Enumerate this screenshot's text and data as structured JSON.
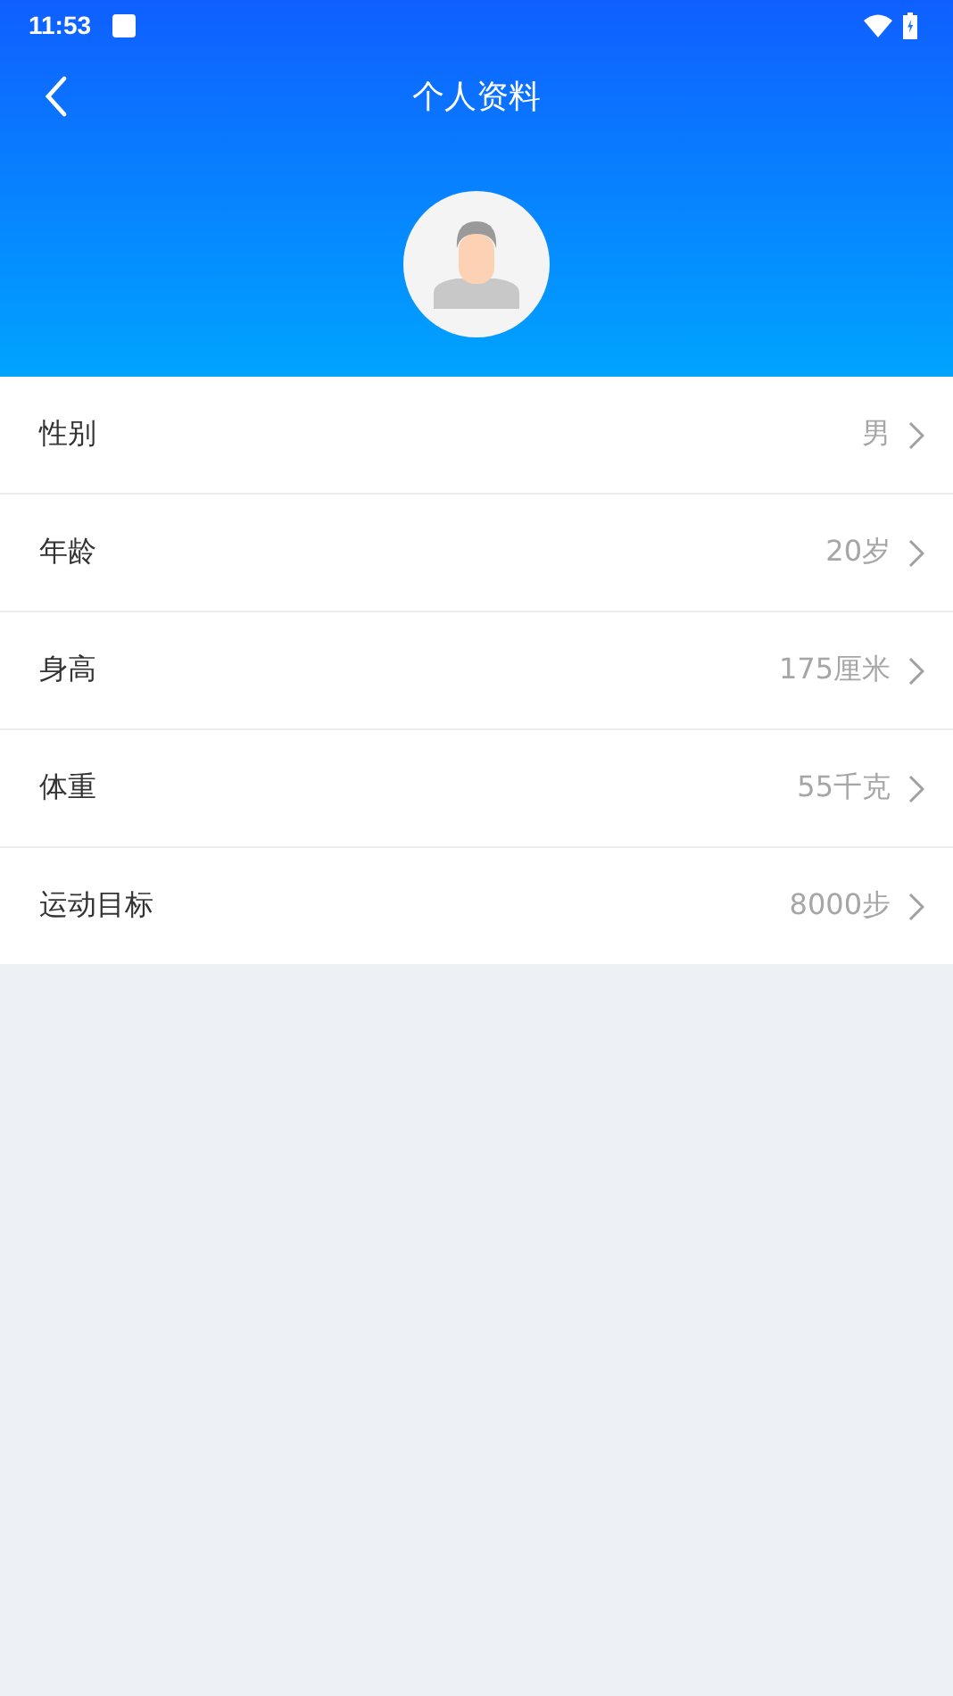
{
  "status_bar": {
    "time": "11:53"
  },
  "header": {
    "title": "个人资料"
  },
  "items": [
    {
      "label": "性别",
      "value": "男"
    },
    {
      "label": "年龄",
      "value": "20岁"
    },
    {
      "label": "身高",
      "value": "175厘米"
    },
    {
      "label": "体重",
      "value": "55千克"
    },
    {
      "label": "运动目标",
      "value": "8000步"
    }
  ]
}
